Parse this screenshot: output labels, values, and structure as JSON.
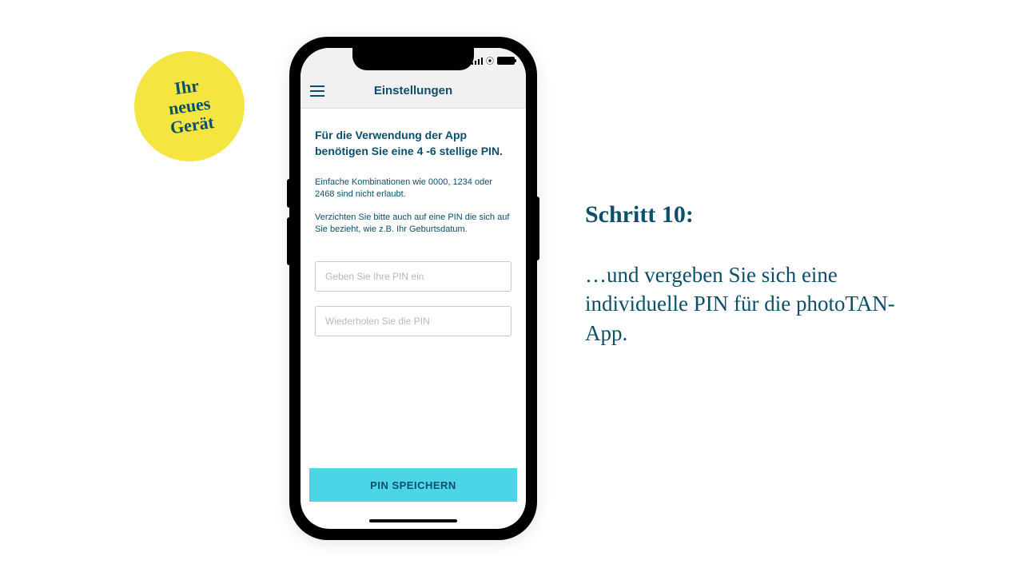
{
  "badge": {
    "line1": "Ihr",
    "line2": "neues",
    "line3": "Gerät"
  },
  "phone": {
    "header_title": "Einstellungen",
    "heading": "Für die Verwendung der App benötigen Sie eine 4 -6 stellige PIN.",
    "info1": "Einfache Kombinationen wie 0000, 1234 oder 2468 sind nicht erlaubt.",
    "info2": "Verzichten Sie bitte auch auf eine PIN die sich auf Sie bezieht, wie z.B. Ihr Geburtsdatum.",
    "input1_placeholder": "Geben Sie Ihre PIN ein",
    "input2_placeholder": "Wiederholen Sie die PIN",
    "save_label": "PIN SPEICHERN"
  },
  "right": {
    "title": "Schritt 10:",
    "body": "…und vergeben Sie sich eine individuelle PIN für die photoTAN-App."
  }
}
